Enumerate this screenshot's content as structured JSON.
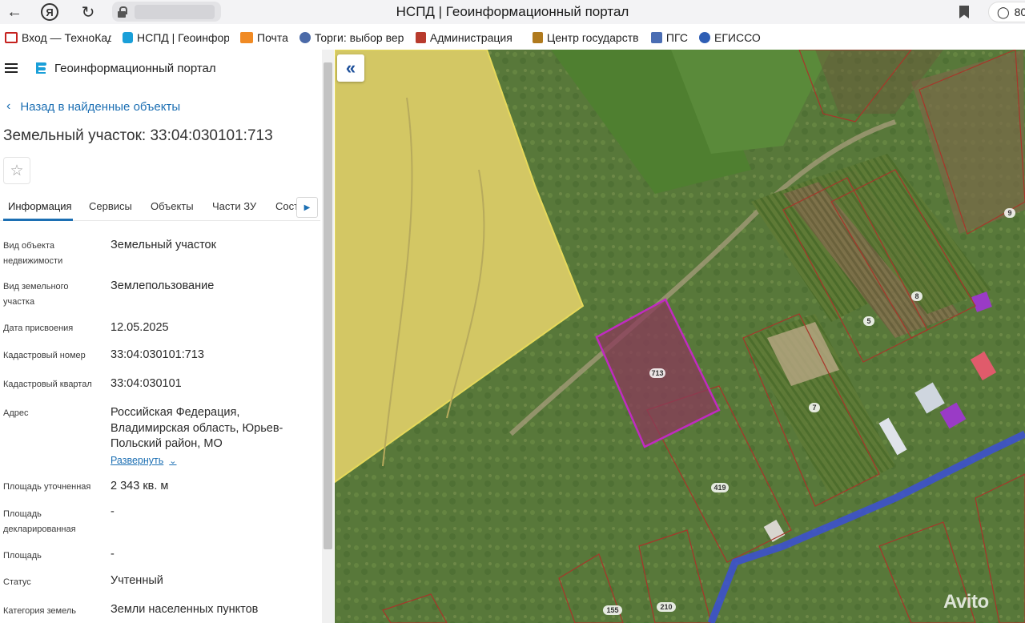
{
  "browser": {
    "title": "НСПД | Геоинформационный портал",
    "right_counter": "80",
    "bookmarks": [
      {
        "label": "Вход — ТехноКад",
        "icon": "gmail-icon",
        "color": "#c5221f"
      },
      {
        "label": "НСПД | Геоинфор",
        "icon": "nspd-icon",
        "color": "#1a9fd8"
      },
      {
        "label": "Почта",
        "icon": "mail-envelope-icon",
        "color": "#f08a24"
      },
      {
        "label": "Торги: выбор вер",
        "icon": "emblem-icon",
        "color": "#4b6aa8"
      },
      {
        "label": "Администрация",
        "icon": "coat-of-arms-icon",
        "color": "#b83b2d"
      },
      {
        "label": "Центр государств",
        "icon": "coat-of-arms-icon",
        "color": "#b07a1e"
      },
      {
        "label": "ПГС",
        "icon": "eagle-icon",
        "color": "#4a6db3"
      },
      {
        "label": "ЕГИССО",
        "icon": "egisso-icon",
        "color": "#2e5eb4"
      }
    ]
  },
  "portal": {
    "title": "Геоинформационный портал",
    "back_label": "Назад в найденные объекты",
    "object_title": "Земельный участок: 33:04:030101:713",
    "tabs": [
      "Информация",
      "Сервисы",
      "Объекты",
      "Части ЗУ",
      "Сост"
    ],
    "properties": [
      {
        "label": "Вид объекта недвижимости",
        "value": "Земельный участок"
      },
      {
        "label": "Вид земельного участка",
        "value": "Землепользование"
      },
      {
        "label": "Дата присвоения",
        "value": "12.05.2025"
      },
      {
        "label": "Кадастровый номер",
        "value": "33:04:030101:713"
      },
      {
        "label": "Кадастровый квартал",
        "value": "33:04:030101"
      },
      {
        "label": "Адрес",
        "value": "Российская Федерация, Владимирская область, Юрьев-Польский район, МО"
      },
      {
        "label": "Площадь уточненная",
        "value": "2 343 кв. м"
      },
      {
        "label": "Площадь декларированная",
        "value": "-"
      },
      {
        "label": "Площадь",
        "value": "-"
      },
      {
        "label": "Статус",
        "value": "Учтенный"
      },
      {
        "label": "Категория земель",
        "value": "Земли населенных пунктов"
      }
    ],
    "expand_label": "Развернуть"
  },
  "map": {
    "parcel_labels": [
      "713",
      "419",
      "7",
      "5",
      "8",
      "9",
      "155",
      "210"
    ],
    "selected_parcel": "713",
    "selected_color": "#c02bc0",
    "boundary_color": "#a8352a",
    "road_color": "#3b4fd6",
    "yellow_zone_color": "#e6d95a",
    "watermark": "Avito"
  }
}
